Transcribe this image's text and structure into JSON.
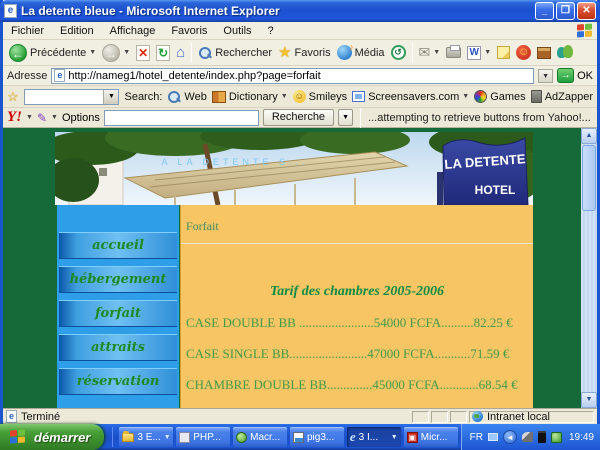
{
  "colors": {
    "page_background": "#166939",
    "content_background": "#F8C565",
    "sidebar_background": "#2E9EE8",
    "content_text_green": "#3E9C46",
    "titlebar_blue": "#1C50CF",
    "taskbar_blue": "#1B4FC8",
    "start_green": "#3A8A2C"
  },
  "window": {
    "title": "La detente bleue - Microsoft Internet Explorer"
  },
  "menu": {
    "items": [
      "Fichier",
      "Edition",
      "Affichage",
      "Favoris",
      "Outils",
      "?"
    ]
  },
  "toolbar": {
    "back": "Précédente",
    "search": "Rechercher",
    "favorites": "Favoris",
    "media": "Média"
  },
  "address": {
    "label": "Adresse",
    "url": "http://nameg1/hotel_detente/index.php?page=forfait",
    "ok": "OK"
  },
  "yahoo": {
    "search_prefix": "Search:",
    "web": "Web",
    "dictionary": "Dictionary",
    "smileys": "Smileys",
    "screensavers": "Screensavers.com",
    "games": "Games",
    "adzapper": "AdZapper"
  },
  "companion": {
    "logo": "Y!",
    "options": "Options",
    "search_button": "Recherche",
    "status": "...attempting to retrieve buttons from Yahoo!..."
  },
  "page": {
    "hero": {
      "overlay": "A  LA  DETENTE  S...",
      "sign_top": "LA DETENTE",
      "sign_bottom": "HOTEL"
    },
    "sidebar": {
      "items": [
        "accueil",
        "hébergement",
        "forfait",
        "attraits",
        "réservation"
      ]
    },
    "content": {
      "heading": "Forfait",
      "title": "Tarif des chambres 2005-2006",
      "rows": [
        "CASE DOUBLE BB .......................54000 FCFA..........82.25 €",
        "CASE SINGLE BB........................47000 FCFA...........71.59 €",
        "CHAMBRE DOUBLE BB..............45000 FCFA............68.54 €"
      ]
    }
  },
  "status": {
    "left": "Terminé",
    "right": "Intranet local"
  },
  "taskbar": {
    "start": "démarrer",
    "buttons": [
      {
        "label": "3 E..."
      },
      {
        "label": "PHP..."
      },
      {
        "label": "Macr..."
      },
      {
        "label": "pig3..."
      },
      {
        "label": "3 I..."
      },
      {
        "label": "Micr..."
      }
    ],
    "tray": {
      "lang": "FR",
      "time": "19:49"
    }
  }
}
